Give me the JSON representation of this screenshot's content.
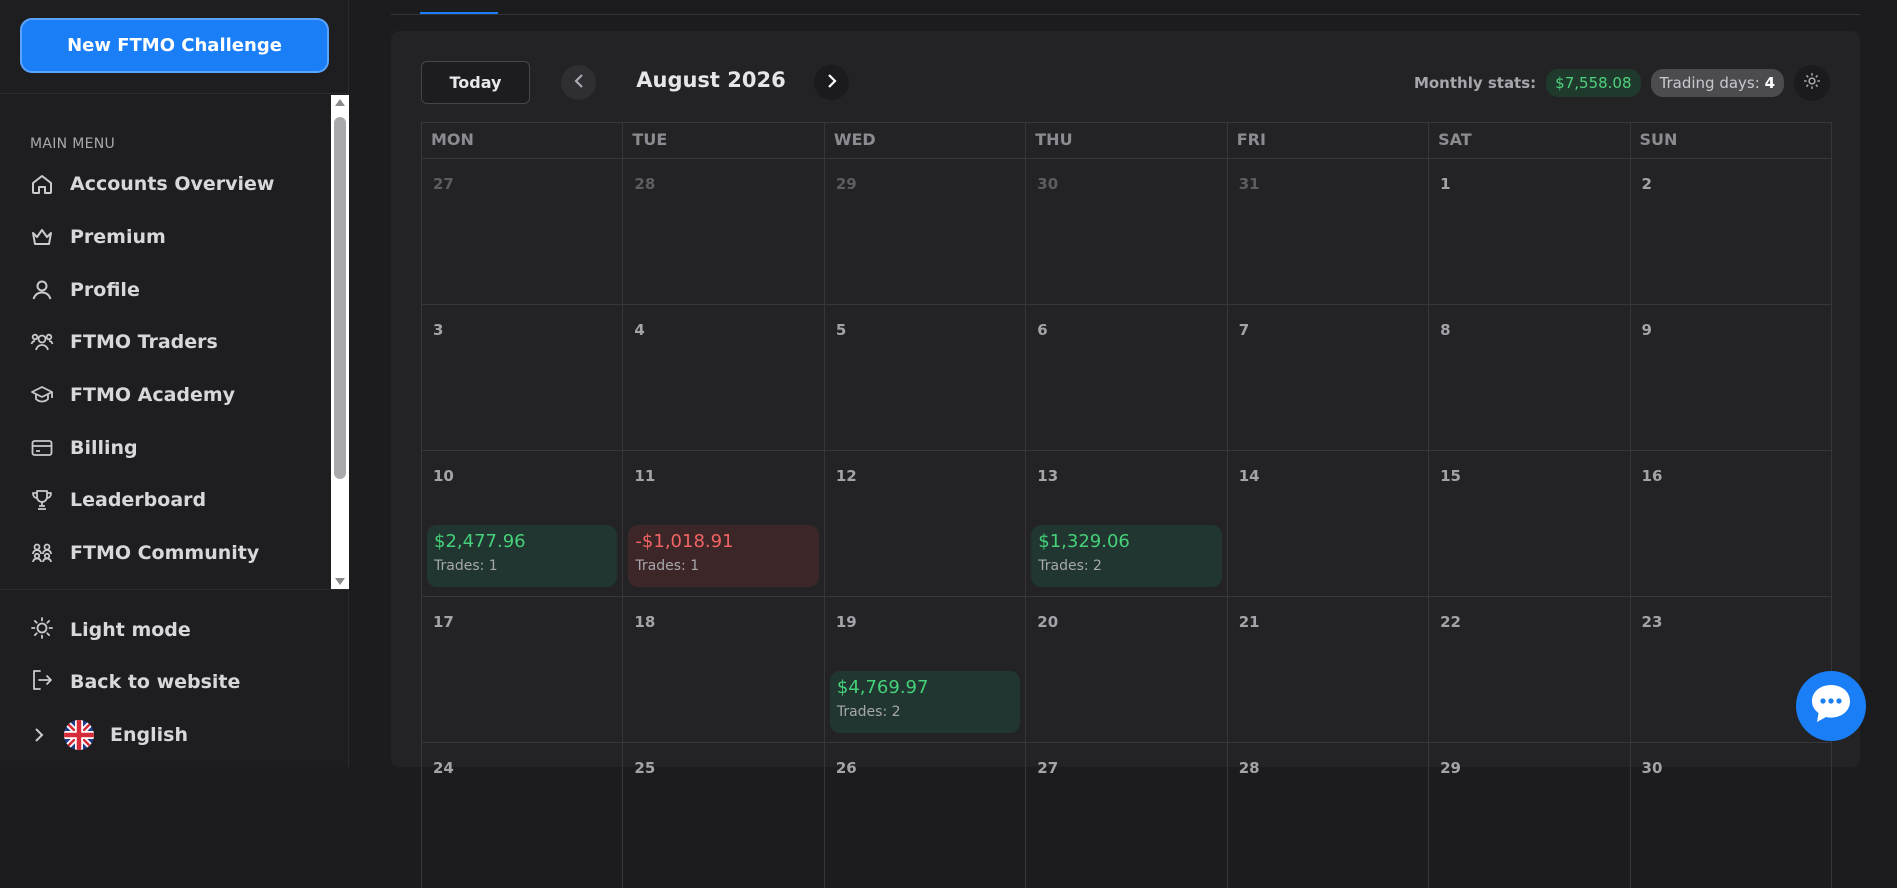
{
  "sidebar": {
    "new_challenge_label": "New FTMO Challenge",
    "menu_heading": "MAIN MENU",
    "items": [
      {
        "label": "Accounts Overview",
        "icon": "home-icon"
      },
      {
        "label": "Premium",
        "icon": "crown-icon"
      },
      {
        "label": "Profile",
        "icon": "user-icon"
      },
      {
        "label": "FTMO Traders",
        "icon": "users-icon"
      },
      {
        "label": "FTMO Academy",
        "icon": "graduation-cap-icon"
      },
      {
        "label": "Billing",
        "icon": "credit-card-icon"
      },
      {
        "label": "Leaderboard",
        "icon": "trophy-icon"
      },
      {
        "label": "FTMO Community",
        "icon": "community-icon"
      }
    ],
    "bottom": {
      "light_mode": "Light mode",
      "back": "Back to website",
      "language": "English"
    }
  },
  "calendar": {
    "today_label": "Today",
    "month_title": "August 2026",
    "stats_label": "Monthly stats:",
    "monthly_pnl": "$7,558.08",
    "trading_days_label": "Trading days:",
    "trading_days_value": "4",
    "weekdays": [
      "MON",
      "TUE",
      "WED",
      "THU",
      "FRI",
      "SAT",
      "SUN"
    ],
    "weeks": [
      [
        {
          "d": "27",
          "dim": true
        },
        {
          "d": "28",
          "dim": true
        },
        {
          "d": "29",
          "dim": true
        },
        {
          "d": "30",
          "dim": true
        },
        {
          "d": "31",
          "dim": true
        },
        {
          "d": "1"
        },
        {
          "d": "2"
        }
      ],
      [
        {
          "d": "3"
        },
        {
          "d": "4"
        },
        {
          "d": "5"
        },
        {
          "d": "6"
        },
        {
          "d": "7"
        },
        {
          "d": "8"
        },
        {
          "d": "9"
        }
      ],
      [
        {
          "d": "10",
          "pnl": "$2,477.96",
          "trades": "Trades: 1",
          "type": "pos"
        },
        {
          "d": "11",
          "pnl": "-$1,018.91",
          "trades": "Trades: 1",
          "type": "neg"
        },
        {
          "d": "12"
        },
        {
          "d": "13",
          "pnl": "$1,329.06",
          "trades": "Trades: 2",
          "type": "pos"
        },
        {
          "d": "14"
        },
        {
          "d": "15"
        },
        {
          "d": "16"
        }
      ],
      [
        {
          "d": "17"
        },
        {
          "d": "18"
        },
        {
          "d": "19",
          "pnl": "$4,769.97",
          "trades": "Trades: 2",
          "type": "pos"
        },
        {
          "d": "20"
        },
        {
          "d": "21"
        },
        {
          "d": "22"
        },
        {
          "d": "23"
        }
      ],
      [
        {
          "d": "24"
        },
        {
          "d": "25"
        },
        {
          "d": "26"
        },
        {
          "d": "27"
        },
        {
          "d": "28"
        },
        {
          "d": "29"
        },
        {
          "d": "30"
        }
      ]
    ]
  },
  "colors": {
    "accent": "#1a7ef7",
    "positive": "#46d07a",
    "negative": "#f16464"
  }
}
